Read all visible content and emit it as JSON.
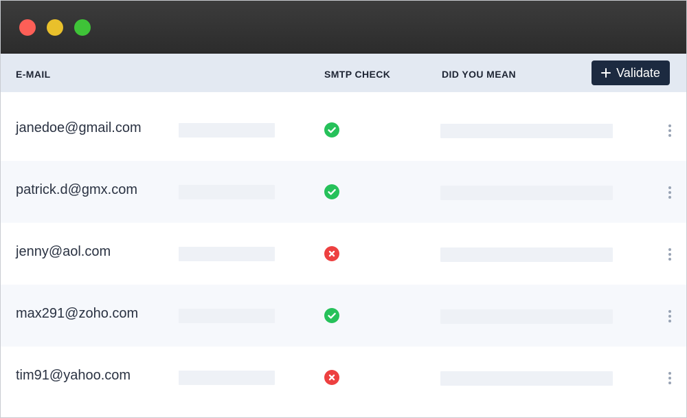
{
  "window": {
    "controls": [
      "close",
      "minimize",
      "maximize"
    ]
  },
  "table": {
    "columns": {
      "email": "E-MAIL",
      "smtp_check": "SMTP CHECK",
      "did_you_mean": "DID YOU MEAN"
    },
    "validate_label": "Validate",
    "validate_icon": "plus-icon",
    "rows": [
      {
        "email": "janedoe@gmail.com",
        "smtp": "valid",
        "status_icon": "check-circle-icon"
      },
      {
        "email": "patrick.d@gmx.com",
        "smtp": "valid",
        "status_icon": "check-circle-icon"
      },
      {
        "email": "jenny@aol.com",
        "smtp": "invalid",
        "status_icon": "x-circle-icon"
      },
      {
        "email": "max291@zoho.com",
        "smtp": "valid",
        "status_icon": "check-circle-icon"
      },
      {
        "email": "tim91@yahoo.com",
        "smtp": "invalid",
        "status_icon": "x-circle-icon"
      }
    ]
  },
  "colors": {
    "valid": "#26c15a",
    "invalid": "#ed4040",
    "button": "#1c2a40",
    "header_bg": "#e3e9f2"
  }
}
